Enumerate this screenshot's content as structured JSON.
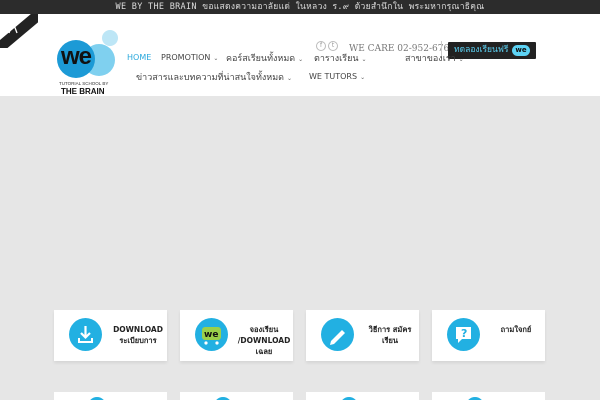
{
  "announcement": "WE BY THE BRAIN ขอแสดงความอาลัยแด่ ในหลวง ร.๙ ด้วยสำนึกใน พระมหากรุณาธิคุณ",
  "logo": {
    "mark": "we",
    "tagline": "TUTORIAL SCHOOL BY",
    "brand": "THE BRAIN"
  },
  "header": {
    "social": [
      "f",
      "t"
    ],
    "care": "WE CARE 02-952-6767",
    "trial_button": "ทดลองเรียนฟรี",
    "trial_badge": "we"
  },
  "nav": [
    {
      "label": "HOME",
      "active": true,
      "has_dropdown": false
    },
    {
      "label": "PROMOTION",
      "active": false,
      "has_dropdown": true
    },
    {
      "label": "คอร์สเรียนทั้งหมด",
      "active": false,
      "has_dropdown": true
    },
    {
      "label": "ตารางเรียน",
      "active": false,
      "has_dropdown": true
    },
    {
      "label": "สาขาของเรา",
      "active": false,
      "has_dropdown": true
    },
    {
      "label": "ข่าวสารและบทความที่น่าสนใจทั้งหมด",
      "active": false,
      "has_dropdown": true
    },
    {
      "label": "WE TUTORS",
      "active": false,
      "has_dropdown": true
    }
  ],
  "cards": [
    {
      "label": "DOWNLOAD ระเบียบการ",
      "icon": "download-icon"
    },
    {
      "label": "จองเรียน /DOWNLOAD เฉลย",
      "icon": "we-cart-icon"
    },
    {
      "label": "วิธีการ สมัครเรียน",
      "icon": "pencil-icon"
    },
    {
      "label": "ถามใจกย์",
      "icon": "question-icon"
    }
  ],
  "colors": {
    "accent": "#22b0e2",
    "topbar": "#2c2c2c",
    "banner": "#e6e6e6"
  }
}
